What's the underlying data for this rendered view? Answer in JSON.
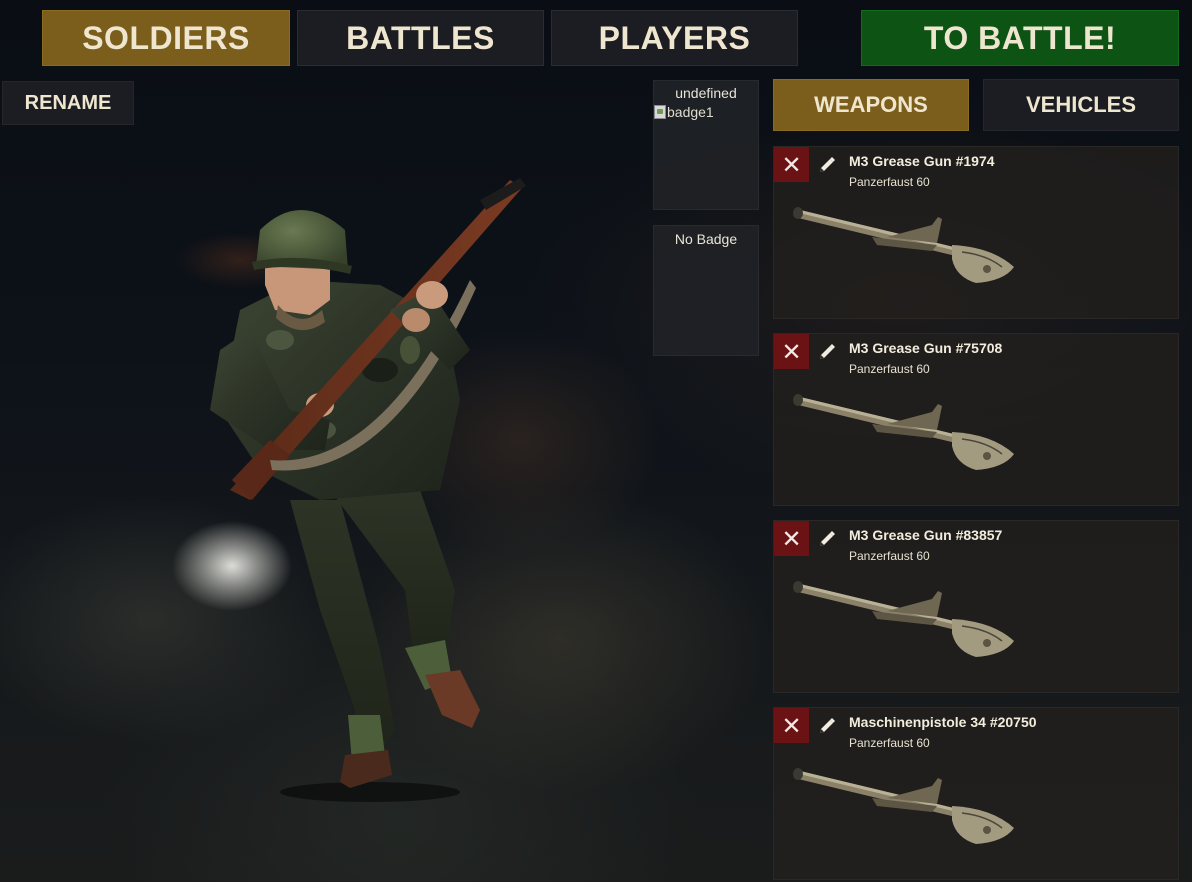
{
  "nav": {
    "soldiers": "SOLDIERS",
    "battles": "BATTLES",
    "players": "PLAYERS",
    "to_battle": "TO BATTLE!",
    "active": "soldiers"
  },
  "soldier_panel": {
    "rename": "RENAME"
  },
  "badges": [
    {
      "title": "undefined",
      "image_alt": "badge1"
    },
    {
      "title": "No Badge"
    }
  ],
  "tabs": {
    "weapons": "WEAPONS",
    "vehicles": "VEHICLES",
    "active": "weapons"
  },
  "weapons": [
    {
      "name": "M3 Grease Gun #1974",
      "type": "Panzerfaust 60"
    },
    {
      "name": "M3 Grease Gun #75708",
      "type": "Panzerfaust 60"
    },
    {
      "name": "M3 Grease Gun #83857",
      "type": "Panzerfaust 60"
    },
    {
      "name": "Maschinenpistole 34 #20750",
      "type": "Panzerfaust 60"
    }
  ],
  "icons": {
    "delete": "close-icon",
    "edit": "pencil-icon"
  },
  "colors": {
    "active_gold": "#7b5e1c",
    "battle_green": "#0c5314",
    "delete_red": "#6b1214",
    "panel_dark": "#1b1d22"
  }
}
